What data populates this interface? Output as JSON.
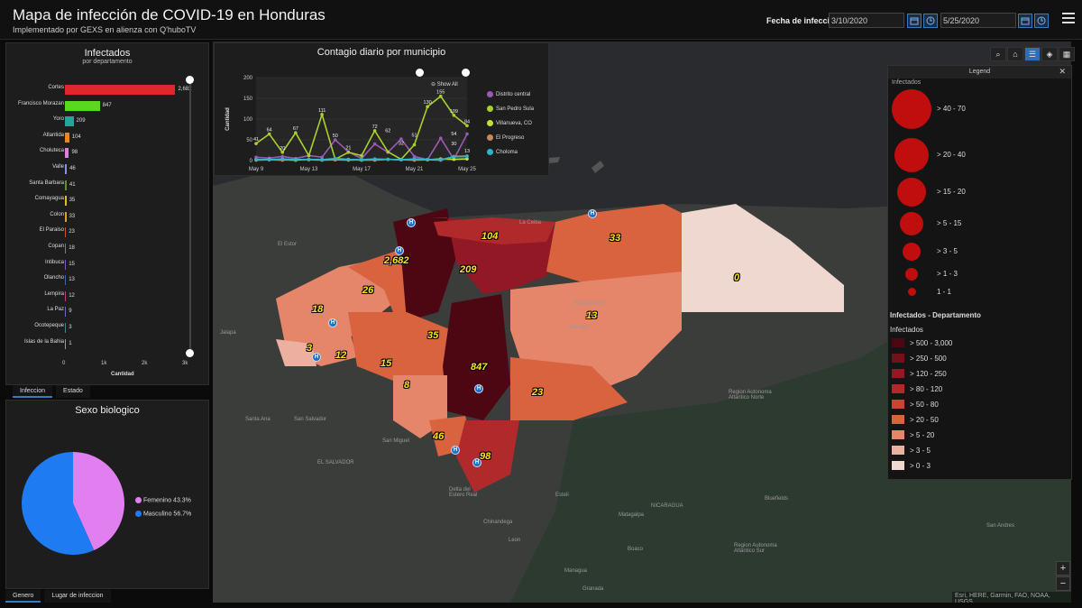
{
  "header": {
    "title": "Mapa de infección de COVID-19 en Honduras",
    "subtitle": "Implementado por GEXS en alienza con Q'huboTV",
    "date_label": "Fecha de infeccion",
    "date_from": "3/10/2020",
    "date_to": "5/25/2020"
  },
  "bar_panel": {
    "title": "Infectados",
    "subtitle": "por departamento",
    "x_label": "Cantidad",
    "x_ticks": [
      "0",
      "1k",
      "2k",
      "3k"
    ],
    "tabs": [
      "Infeccion",
      "Estado"
    ]
  },
  "chart_data": [
    {
      "type": "bar",
      "title": "Infectados",
      "subtitle": "por departamento",
      "xlabel": "Cantidad",
      "xlim": [
        0,
        3000
      ],
      "categories": [
        "Cortes",
        "Francisco Morazan",
        "Yoro",
        "Atlantida",
        "Choluteca",
        "Valle",
        "Santa Barbara",
        "Comayagua",
        "Colon",
        "El Paraiso",
        "Copan",
        "Intibuca",
        "Olancho",
        "Lempira",
        "La Paz",
        "Ocotepeque",
        "Islas de la Bahia"
      ],
      "values": [
        2682,
        847,
        209,
        104,
        98,
        46,
        41,
        35,
        33,
        23,
        18,
        15,
        13,
        12,
        9,
        3,
        1
      ],
      "value_labels": [
        "2,682",
        "847",
        "209",
        "104",
        "98",
        "46",
        "41",
        "35",
        "33",
        "23",
        "18",
        "15",
        "13",
        "12",
        "9",
        "3",
        "1"
      ],
      "colors": [
        "#e0272b",
        "#59d81f",
        "#27a49a",
        "#e08a2a",
        "#e07fd9",
        "#8a8cf0",
        "#6a8a3a",
        "#d6c32a",
        "#d6a03a",
        "#c9582a",
        "#7c7c7c",
        "#7e57c2",
        "#3a6bb0",
        "#c23a8a",
        "#6a6acf",
        "#3a8a8a",
        "#9a9a9a"
      ]
    },
    {
      "type": "line",
      "title": "Contagio diario por municipio",
      "ylabel": "Cantidad",
      "ylim": [
        0,
        200
      ],
      "y_ticks": [
        "0",
        "50",
        "100",
        "150",
        "200"
      ],
      "x_ticks": [
        "May 9",
        "May 13",
        "May 17",
        "May 21",
        "May 25"
      ],
      "x": [
        9,
        10,
        11,
        12,
        13,
        14,
        15,
        16,
        17,
        18,
        19,
        20,
        21,
        22,
        23,
        24,
        25
      ],
      "series": [
        {
          "name": "Distrito central",
          "color": "#9b59b6",
          "values": [
            8,
            6,
            10,
            5,
            12,
            8,
            50,
            21,
            5,
            40,
            20,
            52,
            10,
            2,
            54,
            3,
            64
          ]
        },
        {
          "name": "San Pedro Sula",
          "color": "#a9d12c",
          "values": [
            41,
            64,
            20,
            67,
            12,
            111,
            3,
            20,
            12,
            72,
            21,
            3,
            38,
            130,
            155,
            109,
            84
          ]
        },
        {
          "name": "Villanueva, CO",
          "color": "#c7df35",
          "values": [
            2,
            3,
            2,
            1,
            3,
            2,
            2,
            3,
            1,
            2,
            3,
            2,
            3,
            2,
            4,
            3,
            4
          ]
        },
        {
          "name": "El Progreso",
          "color": "#c98a5a",
          "values": [
            1,
            2,
            1,
            3,
            2,
            1,
            2,
            1,
            2,
            1,
            3,
            2,
            1,
            2,
            1,
            10,
            11
          ]
        },
        {
          "name": "Choloma",
          "color": "#2eb5c8",
          "values": [
            3,
            2,
            4,
            2,
            3,
            2,
            5,
            3,
            2,
            4,
            3,
            2,
            4,
            3,
            2,
            9,
            10
          ]
        }
      ],
      "point_labels": [
        "41",
        "64",
        "20",
        "67",
        "111",
        "50",
        "21",
        "72",
        "62",
        "32",
        "51",
        "130",
        "155",
        "109",
        "84",
        "54",
        "30",
        "13"
      ],
      "show_all_label": "Show All"
    },
    {
      "type": "pie",
      "title": "Sexo biologico",
      "slices": [
        {
          "label": "Femenino",
          "value": 43.3,
          "display": "43.3%",
          "color": "#e17ff0"
        },
        {
          "label": "Masculino",
          "value": 56.7,
          "display": "56.7%",
          "color": "#1e7bf2"
        }
      ]
    }
  ],
  "pie_panel": {
    "title": "Sexo biologico",
    "tabs": [
      "Genero",
      "Lugar de infeccion"
    ]
  },
  "line_panel": {
    "title": "Contagio diario por municipio",
    "ylabel": "Cantidad",
    "show_all": "Show All"
  },
  "map": {
    "department_labels": [
      "104",
      "33",
      "2,682",
      "209",
      "0",
      "26",
      "18",
      "13",
      "3",
      "12",
      "35",
      "15",
      "847",
      "8",
      "23",
      "46",
      "98"
    ],
    "place_labels": [
      "La Ceiba",
      "El Estor",
      "HONDURAS",
      "Santa Ana",
      "San Salvador",
      "San Miguel",
      "EL SALVADOR",
      "Juticalpa",
      "Jalapa",
      "NICARAGUA",
      "Chinandega",
      "Leon",
      "Managua",
      "Region Autonoma Atlantico Norte",
      "Region Autonoma Atlantico Sur",
      "Bluefields",
      "San Andres",
      "Esteli",
      "Matagalpa",
      "Granada",
      "Boaco",
      "Delta del Estero Real"
    ],
    "attribution": "Esri, HERE, Garmin, FAO, NOAA, USGS"
  },
  "legend": {
    "title": "Legend",
    "circle_header": "Infectados",
    "circle_classes": [
      "> 40 - 70",
      "> 20 - 40",
      "> 15 - 20",
      "> 5 - 15",
      "> 3 - 5",
      "> 1 - 3",
      "1 - 1"
    ],
    "layer_title": "Infectados - Departamento",
    "layer_subtitle": "Infectados",
    "classes": [
      {
        "label": "> 500 - 3,000",
        "color": "#4d0713"
      },
      {
        "label": "> 250 - 500",
        "color": "#74101d"
      },
      {
        "label": "> 120 - 250",
        "color": "#931826"
      },
      {
        "label": "> 80 - 120",
        "color": "#b12a2b"
      },
      {
        "label": "> 50 - 80",
        "color": "#c94431"
      },
      {
        "label": "> 20 - 50",
        "color": "#d9623f"
      },
      {
        "label": "> 5 - 20",
        "color": "#e5866a"
      },
      {
        "label": "> 3 - 5",
        "color": "#ebb0a0"
      },
      {
        "label": "> 0 - 3",
        "color": "#eed8d0"
      }
    ]
  },
  "zoom": {
    "in": "+",
    "out": "−"
  }
}
